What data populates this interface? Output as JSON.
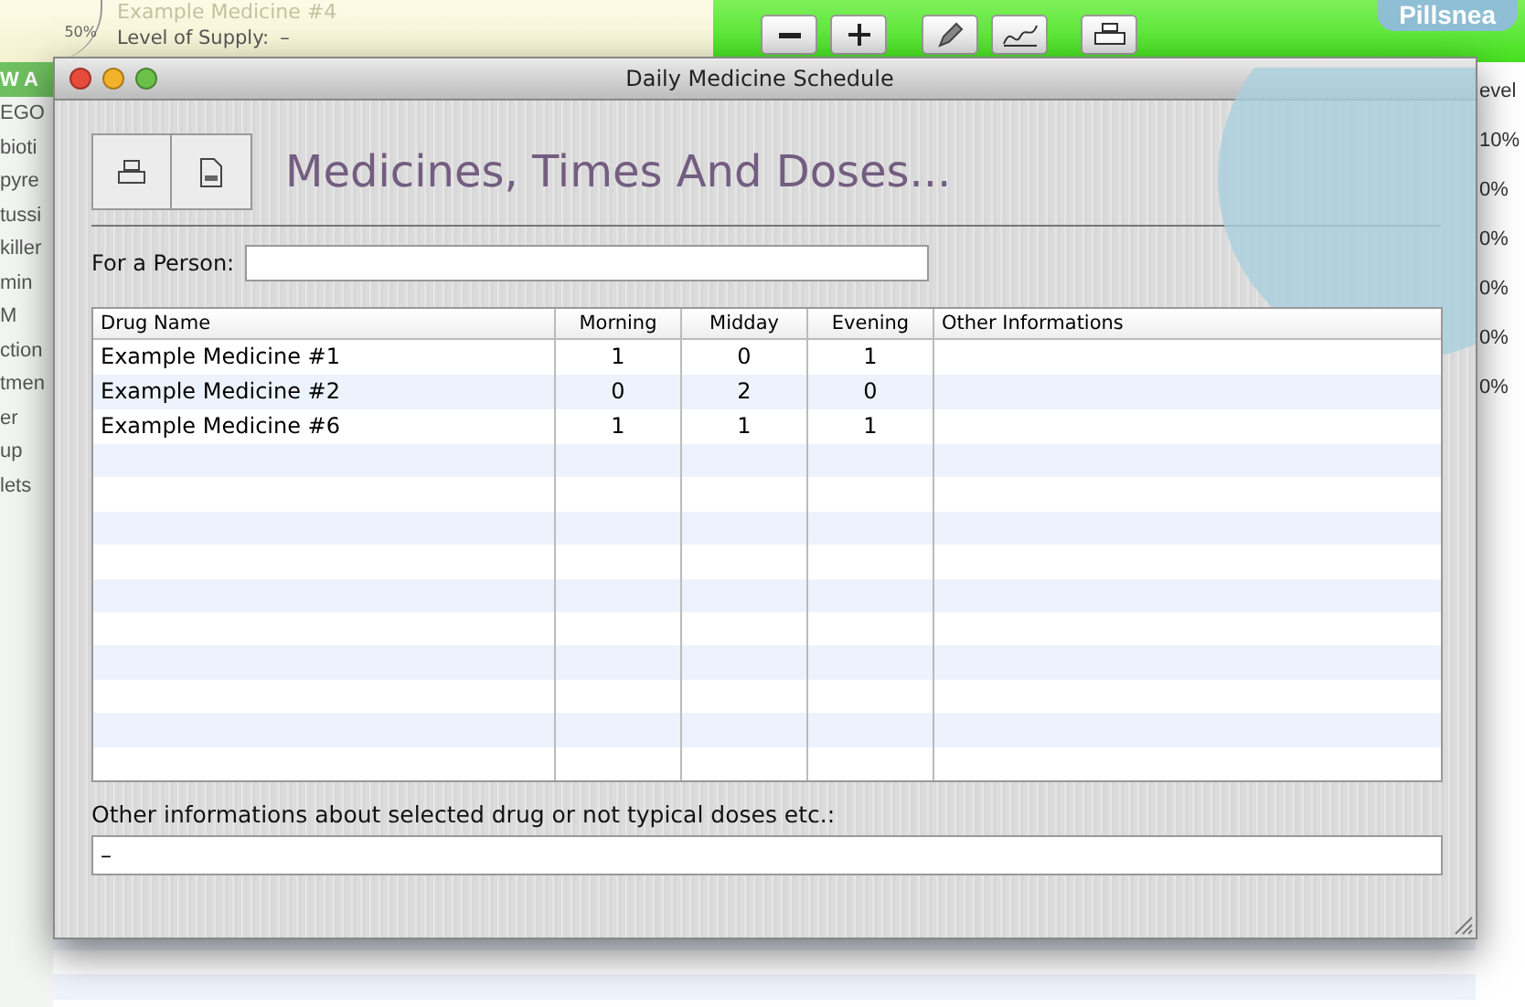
{
  "background_app": {
    "supply": {
      "gauge_label": "50%",
      "medicine": "Example Medicine #4",
      "level_label": "Level of Supply:",
      "level_value": "–"
    },
    "toolbar": [
      {
        "kind": "minus"
      },
      {
        "kind": "plus"
      },
      {
        "kind": "pencil"
      },
      {
        "kind": "signature"
      },
      {
        "kind": "printer"
      }
    ],
    "logo": "Pillsnea",
    "sidebar": {
      "header": "W A",
      "items": [
        "EGO",
        "bioti",
        "pyre",
        "tussi",
        "killer",
        "min",
        "M",
        "ction",
        "tmen",
        "er",
        "up",
        "lets"
      ]
    },
    "level_column": {
      "header": "evel",
      "values": [
        "10%",
        "0%",
        "0%",
        "0%",
        "0%",
        "0%"
      ]
    }
  },
  "window": {
    "title": "Daily Medicine Schedule",
    "toolbar": [
      {
        "kind": "print"
      },
      {
        "kind": "pdf"
      }
    ],
    "heading": "Medicines, Times And Doses...",
    "person": {
      "label": "For a Person:"
    },
    "table": {
      "columns": [
        "Drug Name",
        "Morning",
        "Midday",
        "Evening",
        "Other Informations"
      ],
      "rows": [
        [
          "Example Medicine #1",
          "1",
          "0",
          "1",
          ""
        ],
        [
          "Example Medicine #2",
          "0",
          "2",
          "0",
          ""
        ],
        [
          "Example Medicine #6",
          "1",
          "1",
          "1",
          ""
        ]
      ]
    },
    "notes": {
      "label": "Other informations about selected drug or not typical doses etc.:",
      "value": "–"
    }
  }
}
